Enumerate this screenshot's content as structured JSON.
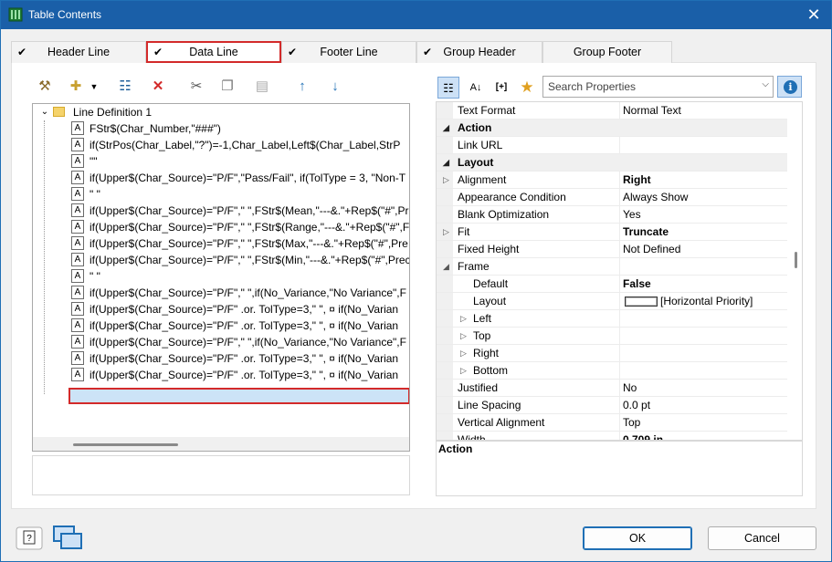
{
  "window": {
    "title": "Table Contents",
    "close_glyph": "✕"
  },
  "tabs": [
    {
      "label": "Header Line",
      "checked": true
    },
    {
      "label": "Data Line",
      "checked": true
    },
    {
      "label": "Footer Line",
      "checked": true
    },
    {
      "label": "Group Header",
      "checked": true
    },
    {
      "label": "Group Footer",
      "checked": false
    }
  ],
  "check_glyph": "✔",
  "left_toolbar": [
    "wand-icon",
    "new-line-icon",
    "dropdown-arrow-icon",
    "properties-icon",
    "delete-icon",
    "cut-icon",
    "copy-icon",
    "paste-icon",
    "move-up-icon",
    "move-down-icon"
  ],
  "tree": {
    "root": "Line Definition  1",
    "items": [
      "FStr$(Char_Number,\"###\")",
      "if(StrPos(Char_Label,\"?\")=-1,Char_Label,Left$(Char_Label,StrP",
      "\"\"",
      "if(Upper$(Char_Source)=\"P/F\",\"Pass/Fail\", if(TolType = 3, \"Non-T",
      "\" \"",
      "if(Upper$(Char_Source)=\"P/F\",\" \",FStr$(Mean,\"---&.\"+Rep$(\"#\",Pr",
      "if(Upper$(Char_Source)=\"P/F\",\" \",FStr$(Range,\"---&.\"+Rep$(\"#\",F",
      "if(Upper$(Char_Source)=\"P/F\",\" \",FStr$(Max,\"---&.\"+Rep$(\"#\",Pre",
      "if(Upper$(Char_Source)=\"P/F\",\" \",FStr$(Min,\"---&.\"+Rep$(\"#\",Prec",
      "\" \"",
      "if(Upper$(Char_Source)=\"P/F\",\" \",if(No_Variance,\"No Variance\",F",
      "if(Upper$(Char_Source)=\"P/F\" .or. TolType=3,\" \", ¤  if(No_Varian",
      "if(Upper$(Char_Source)=\"P/F\" .or. TolType=3,\" \", ¤  if(No_Varian",
      "if(Upper$(Char_Source)=\"P/F\",\" \",if(No_Variance,\"No Variance\",F",
      "if(Upper$(Char_Source)=\"P/F\" .or. TolType=3,\" \", ¤  if(No_Varian",
      "if(Upper$(Char_Source)=\"P/F\" .or. TolType=3,\" \", ¤  if(No_Varian"
    ],
    "selected_index": 10
  },
  "search": {
    "placeholder": "Search Properties"
  },
  "properties": [
    {
      "name": "Text Format",
      "value": "Normal Text",
      "kind": "prop"
    },
    {
      "name": "Action",
      "value": "",
      "kind": "cat",
      "exp": "◢"
    },
    {
      "name": "Link URL",
      "value": "",
      "kind": "prop"
    },
    {
      "name": "Layout",
      "value": "",
      "kind": "cat",
      "exp": "◢"
    },
    {
      "name": "Alignment",
      "value": "Right",
      "kind": "prop",
      "exp": "▷",
      "bold": true
    },
    {
      "name": "Appearance Condition",
      "value": "Always Show",
      "kind": "prop"
    },
    {
      "name": "Blank Optimization",
      "value": "Yes",
      "kind": "prop"
    },
    {
      "name": "Fit",
      "value": "Truncate",
      "kind": "prop",
      "exp": "▷",
      "bold": true
    },
    {
      "name": "Fixed Height",
      "value": "Not Defined",
      "kind": "prop"
    },
    {
      "name": "Frame",
      "value": "",
      "kind": "prop",
      "exp": "◢"
    },
    {
      "name": "Default",
      "value": "False",
      "kind": "sub",
      "bold": true
    },
    {
      "name": "Layout",
      "value": "[Horizontal Priority]",
      "kind": "sub",
      "swatch": true
    },
    {
      "name": "Left",
      "value": "",
      "kind": "sub",
      "exp": "▷"
    },
    {
      "name": "Top",
      "value": "",
      "kind": "sub",
      "exp": "▷"
    },
    {
      "name": "Right",
      "value": "",
      "kind": "sub",
      "exp": "▷"
    },
    {
      "name": "Bottom",
      "value": "",
      "kind": "sub",
      "exp": "▷"
    },
    {
      "name": "Justified",
      "value": "No",
      "kind": "prop"
    },
    {
      "name": "Line Spacing",
      "value": "0.0 pt",
      "kind": "prop"
    },
    {
      "name": "Vertical Alignment",
      "value": "Top",
      "kind": "prop"
    },
    {
      "name": "Width",
      "value": "0.709 in",
      "kind": "prop",
      "bold": true
    }
  ],
  "description": {
    "title": "Action"
  },
  "buttons": {
    "ok": "OK",
    "cancel": "Cancel"
  },
  "colors": {
    "titlebar": "#1a5fa8",
    "highlight_border": "#d32a2a",
    "selection": "#cce3f7"
  }
}
